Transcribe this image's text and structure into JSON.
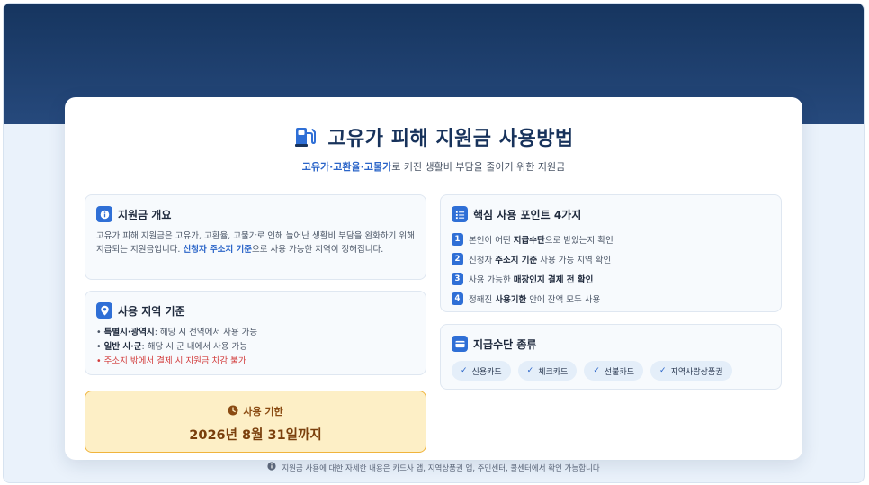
{
  "header": {
    "title": "고유가 피해 지원금 사용방법",
    "subtitle_highlight": "고유가·고환율·고물가",
    "subtitle_rest": "로 커진 생활비 부담을 줄이기 위한 지원금"
  },
  "overview": {
    "title": "지원금 개요",
    "text_before": "고유가 피해 지원금은 고유가, 고환율, 고물가로 인해 늘어난 생활비 부담을 완화하기 위해 지급되는 지원금입니다. ",
    "text_highlight": "신청자 주소지 기준",
    "text_after": "으로 사용 가능한 지역이 정해집니다."
  },
  "region": {
    "title": "사용 지역 기준",
    "items": [
      {
        "bold": "특별시·광역시",
        "text": ": 해당 시 전역에서 사용 가능"
      },
      {
        "bold": "일반 시·군",
        "text": ": 해당 시·군 내에서 사용 가능"
      }
    ],
    "warning": "주소지 밖에서 결제 시 지원금 차감 불가"
  },
  "deadline": {
    "label": "사용 기한",
    "date": "2026년 8월 31일까지"
  },
  "points": {
    "title": "핵심 사용 포인트 4가지",
    "items": [
      {
        "num": "1",
        "pre": "본인이 어떤 ",
        "bold": "지급수단",
        "post": "으로 받았는지 확인"
      },
      {
        "num": "2",
        "pre": "신청자 ",
        "bold": "주소지 기준",
        "post": " 사용 가능 지역 확인"
      },
      {
        "num": "3",
        "pre": "사용 가능한 ",
        "bold": "매장인지 결제 전 확인",
        "post": ""
      },
      {
        "num": "4",
        "pre": "정해진 ",
        "bold": "사용기한",
        "post": " 안에 잔액 모두 사용"
      }
    ]
  },
  "methods": {
    "title": "지급수단 종류",
    "chips": [
      "신용카드",
      "체크카드",
      "선불카드",
      "지역사랑상품권"
    ]
  },
  "footer": {
    "text": "지원금 사용에 대한 자세한 내용은 카드사 앱, 지역상품권 앱, 주민센터, 콜센터에서 확인 가능합니다"
  },
  "colors": {
    "navy": "#17325b",
    "accent": "#2f6fd6",
    "warning": "#d23c3c",
    "deadline_bg": "#fdefc6",
    "deadline_border": "#f0b43c"
  },
  "icons": {
    "title": "fuel-pump-icon",
    "overview": "info-icon",
    "region": "location-pin-icon",
    "deadline": "clock-icon",
    "points": "checklist-icon",
    "methods": "card-icon",
    "footer": "info-icon",
    "chip": "check-icon"
  }
}
